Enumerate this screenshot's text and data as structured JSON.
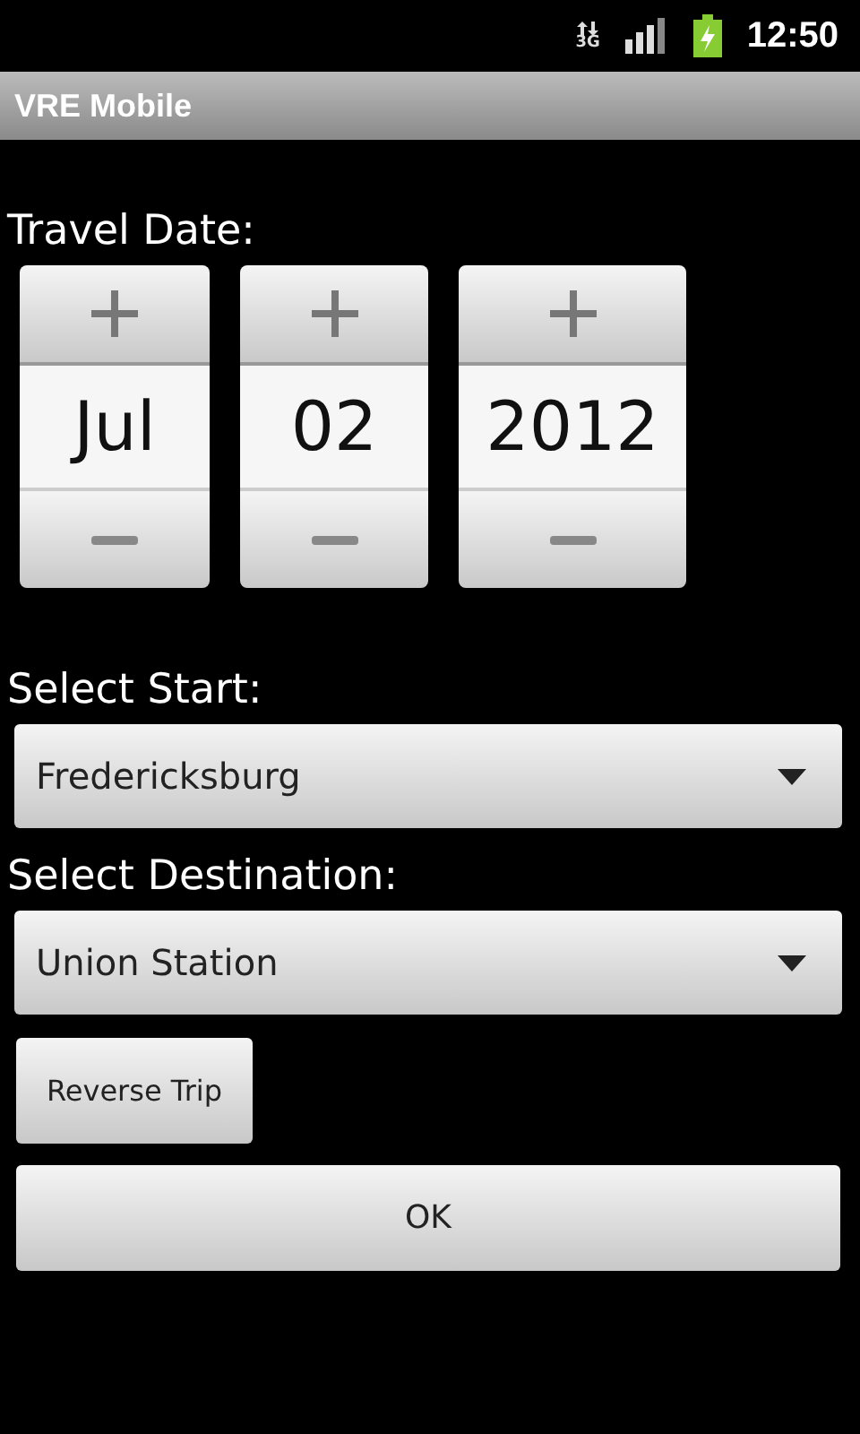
{
  "status_bar": {
    "network_type": "3G",
    "time": "12:50"
  },
  "title_bar": {
    "title": "VRE Mobile"
  },
  "travel_date": {
    "label": "Travel Date:",
    "fields": [
      {
        "value": "Jul"
      },
      {
        "value": "02"
      },
      {
        "value": "2012"
      }
    ]
  },
  "start": {
    "label": "Select Start:",
    "value": "Fredericksburg"
  },
  "destination": {
    "label": "Select Destination:",
    "value": "Union Station"
  },
  "buttons": [
    "Reverse Trip",
    "OK"
  ]
}
